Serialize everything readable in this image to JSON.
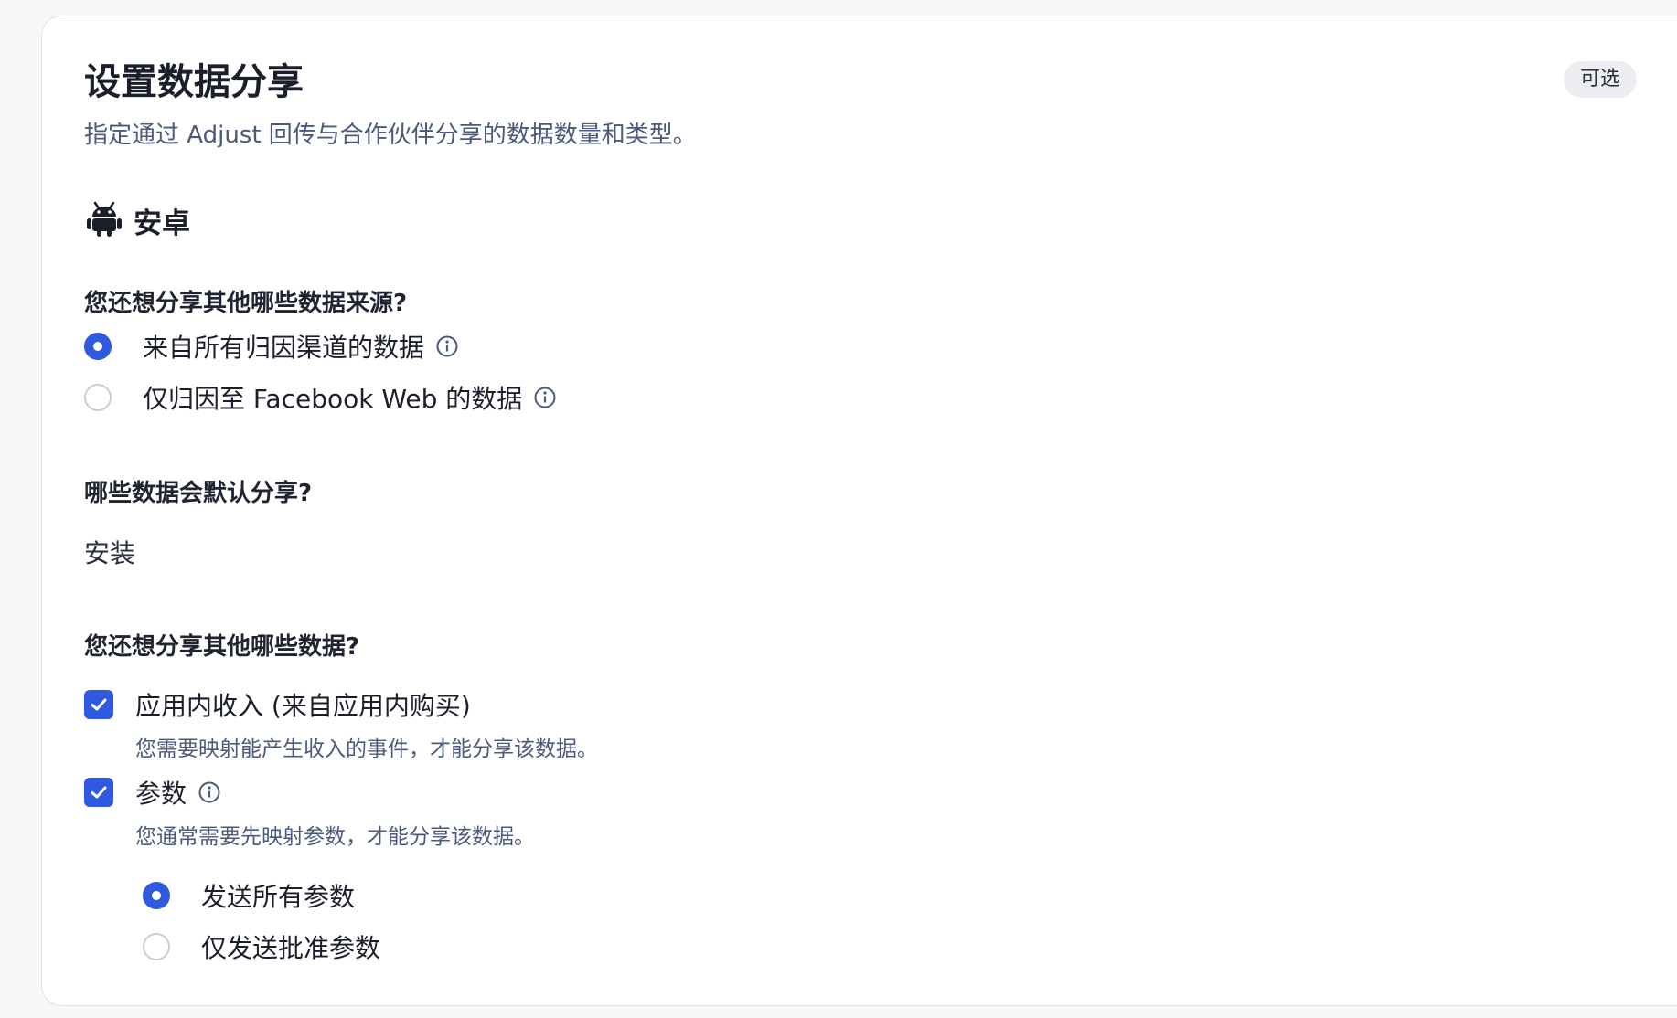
{
  "header": {
    "title": "设置数据分享",
    "subtitle": "指定通过 Adjust 回传与合作伙伴分享的数据数量和类型。",
    "badge": "可选"
  },
  "platform": {
    "icon": "android-icon",
    "label": "安卓"
  },
  "source_question": {
    "label": "您还想分享其他哪些数据来源?",
    "options": [
      {
        "label": "来自所有归因渠道的数据",
        "selected": true
      },
      {
        "label": "仅归因至 Facebook Web 的数据",
        "selected": false
      }
    ]
  },
  "default_question": {
    "label": "哪些数据会默认分享?",
    "value": "安装"
  },
  "extra_question": {
    "label": "您还想分享其他哪些数据?",
    "items": [
      {
        "label": "应用内收入 (来自应用内购买)",
        "help": "您需要映射能产生收入的事件，才能分享该数据。",
        "checked": true
      },
      {
        "label": "参数",
        "help": "您通常需要先映射参数，才能分享该数据。",
        "checked": true
      }
    ]
  },
  "params_options": [
    {
      "label": "发送所有参数",
      "selected": true
    },
    {
      "label": "仅发送批准参数",
      "selected": false
    }
  ],
  "colors": {
    "accent": "#2f5ae0",
    "muted_text": "#4b5a7c"
  }
}
